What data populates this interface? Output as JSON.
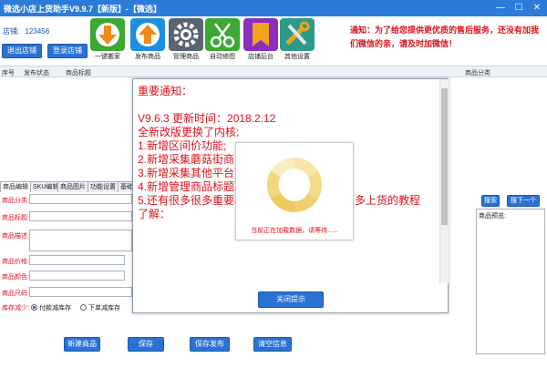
{
  "window": {
    "title": "微选小店上货助手V9.9.7【新版】-【微选】",
    "minimize": "—",
    "maximize": "☐",
    "close": "✕"
  },
  "header": {
    "store_label": "店铺:",
    "store_number": "123456",
    "logout_label": "退出店铺",
    "login_label": "登录店铺",
    "notice": "通知：为了给您提供更优质的售后服务，还没有加我们微信的亲，请及时加微信！"
  },
  "toolbar": [
    {
      "label": "一键搬家",
      "icon": "download-icon",
      "color": "#3aa832"
    },
    {
      "label": "发布商品",
      "icon": "upload-icon",
      "color": "#1e8fe0"
    },
    {
      "label": "管理商品",
      "icon": "gear-icon",
      "color": "#5a6470"
    },
    {
      "label": "自动修图",
      "icon": "scissors-icon",
      "color": "#3aa832"
    },
    {
      "label": "店铺后台",
      "icon": "bookmark-icon",
      "color": "#8a2ec0"
    },
    {
      "label": "其他设置",
      "icon": "tools-icon",
      "color": "#2a9a8a"
    }
  ],
  "table": {
    "columns": [
      "序号",
      "发布状态",
      "商品标题",
      "商品分类"
    ]
  },
  "tabs": [
    "商品编辑",
    "SKU编辑",
    "商品图片",
    "功能设置",
    "基础设置"
  ],
  "form": {
    "category_label": "商品分类:",
    "title_label": "商品标题:",
    "desc_label": "商品描述:",
    "price_label": "商品价格:",
    "color_label": "商品颜色:",
    "size_label": "商品尺码:",
    "stock_label": "库存减少:",
    "radio_pay": "付款减库存",
    "radio_order": "下单减库存",
    "search_label": "搜索",
    "next_label": "搜下一个",
    "preview_label": "商品预览:"
  },
  "bottom_buttons": [
    "新建商品",
    "保存",
    "保存发布",
    "清空信息"
  ],
  "modal": {
    "lines": [
      "重要通知：",
      "",
      "V9.6.3 更新时间：2018.2.12",
      "全新改版更换了内核;",
      "1.新增区间价功能;",
      "2.新增采集蘑菇街商品功能;",
      "3.新增采集其他平台商品分类功能;",
      "4.新增管理商品标题功能;",
      "5.还有很多很多重要功能，等待您的发现，更多上货的教程",
      "了解："
    ],
    "close_label": "关闭提示"
  },
  "loading": {
    "text": "当前正在加载数据，请等待......",
    "color": "#f0d878"
  }
}
